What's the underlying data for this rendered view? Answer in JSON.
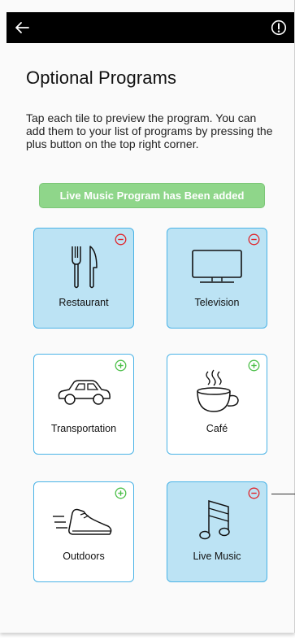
{
  "header": {
    "back_icon": "arrow-left-icon",
    "info_icon": "info-circle-icon",
    "background": "#000000"
  },
  "page": {
    "title": "Optional Programs",
    "description": "Tap each tile to preview the program. You can add them to your list of programs by pressing the plus button on the top right corner."
  },
  "banner": {
    "text": "Live Music Program has Been added",
    "color": "#8fd68a"
  },
  "colors": {
    "added_tile": "#bce3f4",
    "tile_border": "#4ab3e6",
    "remove": "#e0252b",
    "add": "#4dbf4a"
  },
  "tiles": [
    {
      "label": "Restaurant",
      "icon": "fork-knife-icon",
      "state": "added",
      "action_icon": "minus-circle-icon"
    },
    {
      "label": "Television",
      "icon": "television-icon",
      "state": "added",
      "action_icon": "minus-circle-icon"
    },
    {
      "label": "Transportation",
      "icon": "car-icon",
      "state": "available",
      "action_icon": "plus-circle-icon"
    },
    {
      "label": "Café",
      "icon": "coffee-cup-icon",
      "state": "available",
      "action_icon": "plus-circle-icon"
    },
    {
      "label": "Outdoors",
      "icon": "running-shoe-icon",
      "state": "available",
      "action_icon": "plus-circle-icon"
    },
    {
      "label": "Live Music",
      "icon": "music-note-icon",
      "state": "added",
      "action_icon": "minus-circle-icon"
    }
  ]
}
